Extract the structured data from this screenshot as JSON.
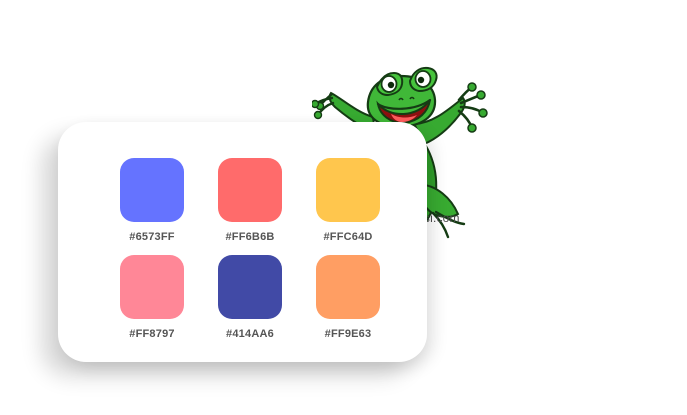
{
  "watermark": {
    "text": "dsi.com"
  },
  "palette": {
    "swatches": [
      {
        "hex": "#6573FF",
        "label": "#6573FF"
      },
      {
        "hex": "#FF6B6B",
        "label": "#FF6B6B"
      },
      {
        "hex": "#FFC64D",
        "label": "#FFC64D"
      },
      {
        "hex": "#FF8797",
        "label": "#FF8797"
      },
      {
        "hex": "#414AA6",
        "label": "#414AA6"
      },
      {
        "hex": "#FF9E63",
        "label": "#FF9E63"
      }
    ]
  },
  "illustration": {
    "icon": "frog-icon"
  }
}
